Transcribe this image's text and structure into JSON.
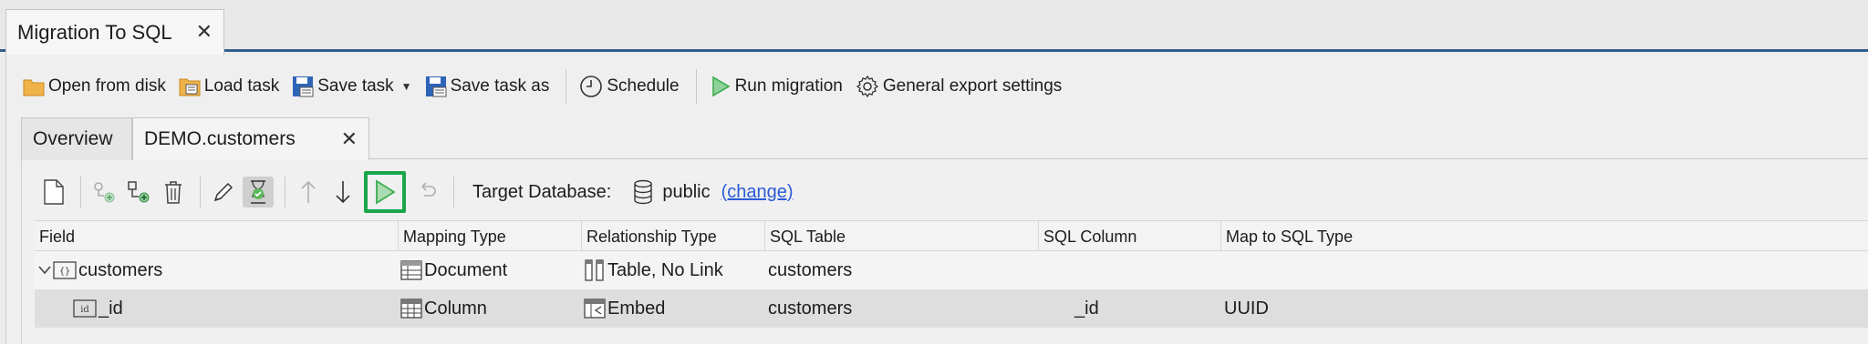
{
  "document_tab": {
    "title": "Migration To SQL",
    "close": "✕"
  },
  "toolbar": {
    "open_from_disk": "Open from disk",
    "load_task": "Load task",
    "save_task": "Save task",
    "save_task_as": "Save task as",
    "schedule": "Schedule",
    "run_migration": "Run migration",
    "general_export_settings": "General export settings"
  },
  "inner_tabs": [
    {
      "label": "Overview"
    },
    {
      "label": "DEMO.customers",
      "close": "✕"
    }
  ],
  "target": {
    "label": "Target Database:",
    "value": "public",
    "change_link": "(change)"
  },
  "table": {
    "columns": [
      "Field",
      "Mapping Type",
      "Relationship Type",
      "SQL Table",
      "SQL Column",
      "Map to SQL Type"
    ],
    "rows": [
      {
        "field": "customers",
        "mapping_type": "Document",
        "relationship_type": "Table, No Link",
        "sql_table": "customers",
        "sql_column": "",
        "sql_type": ""
      },
      {
        "field": "_id",
        "mapping_type": "Column",
        "relationship_type": "Embed",
        "sql_table": "customers",
        "sql_column": "_id",
        "sql_type": "UUID"
      }
    ]
  },
  "colors": {
    "accent_border": "#2f5e8c",
    "run_highlight": "#1aa64a",
    "link": "#2a5bd7",
    "run_green": "#3fae4f"
  }
}
